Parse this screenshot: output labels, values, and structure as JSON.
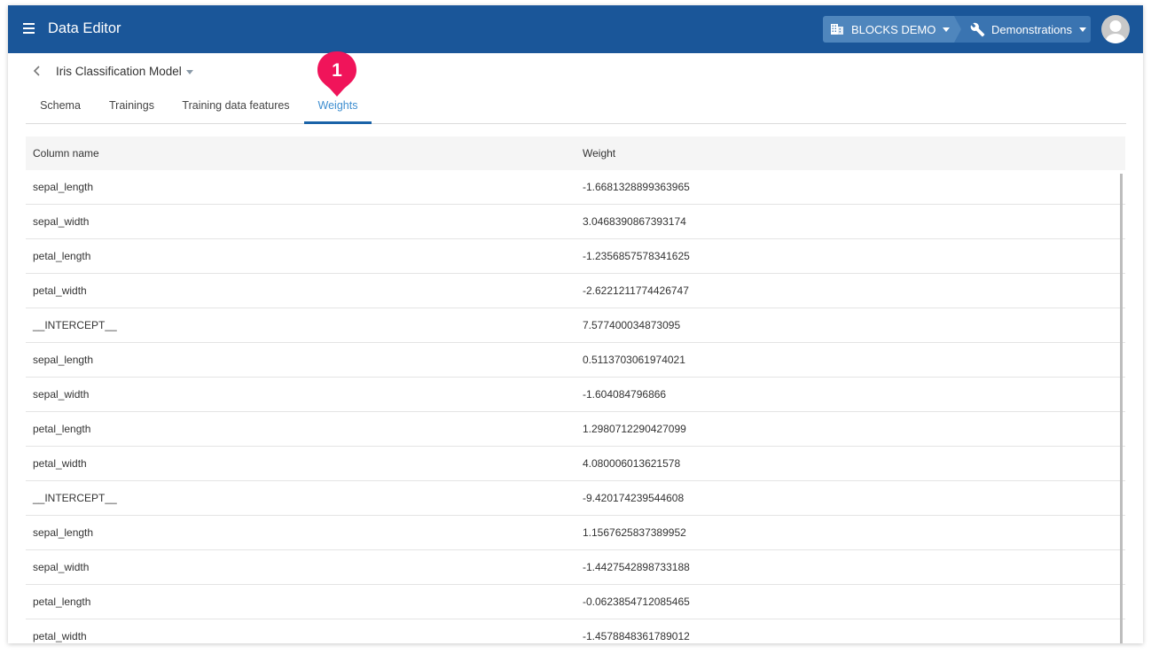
{
  "appbar": {
    "title": "Data Editor",
    "organization": "BLOCKS DEMO",
    "project": "Demonstrations"
  },
  "model": {
    "name": "Iris Classification Model"
  },
  "tabs": [
    {
      "label": "Schema",
      "active": false
    },
    {
      "label": "Trainings",
      "active": false
    },
    {
      "label": "Training data features",
      "active": false
    },
    {
      "label": "Weights",
      "active": true
    }
  ],
  "marker": {
    "label": "1",
    "color": "#f0145a"
  },
  "table": {
    "headers": [
      "Column name",
      "Weight"
    ],
    "rows": [
      [
        "sepal_length",
        "-1.6681328899363965"
      ],
      [
        "sepal_width",
        "3.0468390867393174"
      ],
      [
        "petal_length",
        "-1.2356857578341625"
      ],
      [
        "petal_width",
        "-2.6221211774426747"
      ],
      [
        "__INTERCEPT__",
        "7.577400034873095"
      ],
      [
        "sepal_length",
        "0.5113703061974021"
      ],
      [
        "sepal_width",
        "-1.604084796866"
      ],
      [
        "petal_length",
        "1.2980712290427099"
      ],
      [
        "petal_width",
        "4.080006013621578"
      ],
      [
        "__INTERCEPT__",
        "-9.420174239544608"
      ],
      [
        "sepal_length",
        "1.1567625837389952"
      ],
      [
        "sepal_width",
        "-1.4427542898733188"
      ],
      [
        "petal_length",
        "-0.0623854712085465"
      ],
      [
        "petal_width",
        "-1.4578848361789012"
      ]
    ]
  },
  "colors": {
    "appbar": "#1a5699",
    "active_tab": "#3e8ed0",
    "marker": "#f0145a"
  }
}
